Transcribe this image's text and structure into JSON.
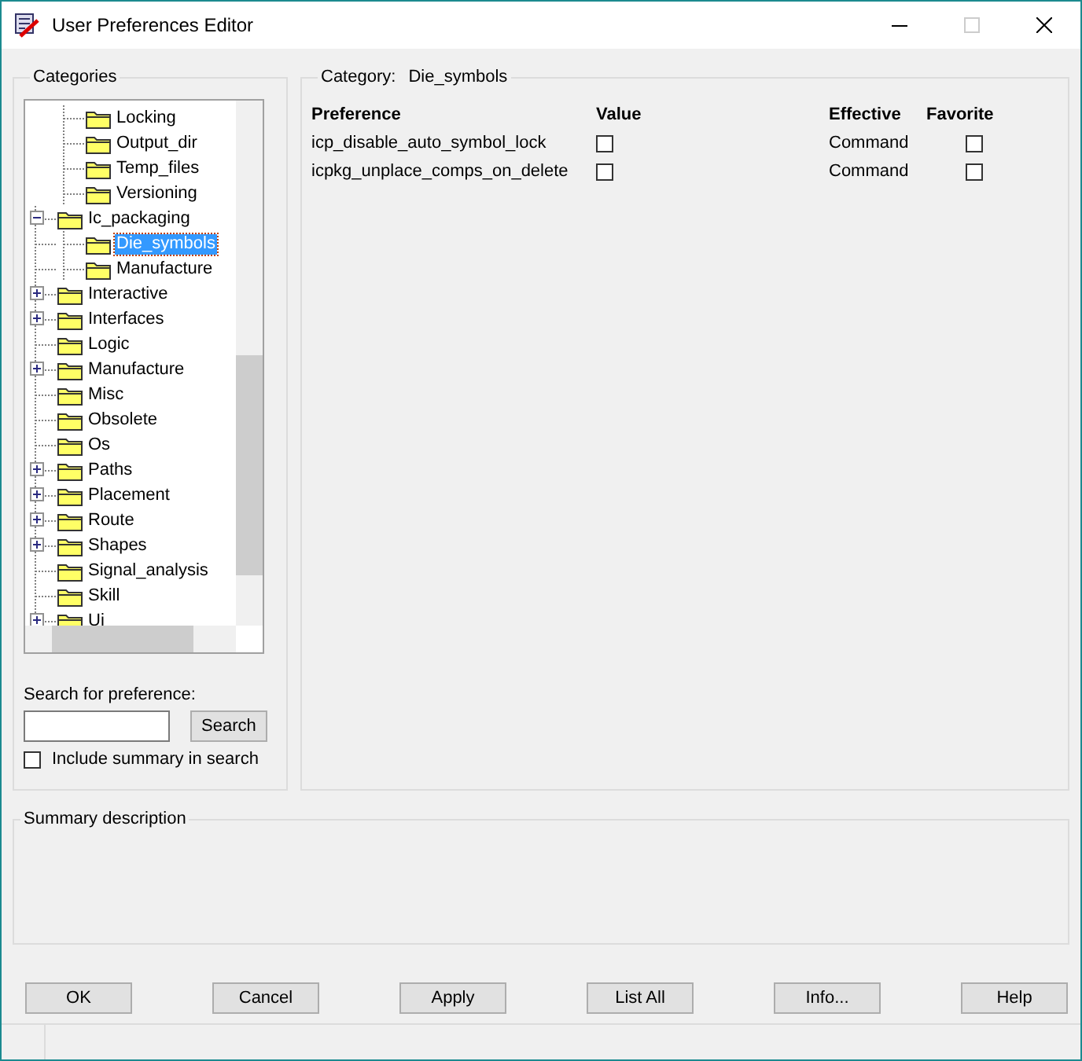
{
  "window": {
    "title": "User Preferences Editor"
  },
  "categories": {
    "title": "Categories",
    "tree": [
      {
        "kind": "offscreen",
        "children": [
          {
            "label": "Locking",
            "kind": "leaf",
            "selected": false
          },
          {
            "label": "Output_dir",
            "kind": "leaf",
            "selected": false
          },
          {
            "label": "Temp_files",
            "kind": "leaf",
            "selected": false
          },
          {
            "label": "Versioning",
            "kind": "leaf",
            "selected": false
          }
        ]
      },
      {
        "label": "Ic_packaging",
        "kind": "branch",
        "expanded": true,
        "selected": false,
        "children": [
          {
            "label": "Die_symbols",
            "kind": "leaf",
            "selected": true
          },
          {
            "label": "Manufacture",
            "kind": "leaf",
            "selected": false
          }
        ]
      },
      {
        "label": "Interactive",
        "kind": "branch",
        "expanded": false,
        "selected": false
      },
      {
        "label": "Interfaces",
        "kind": "branch",
        "expanded": false,
        "selected": false
      },
      {
        "label": "Logic",
        "kind": "leaf",
        "selected": false
      },
      {
        "label": "Manufacture",
        "kind": "branch",
        "expanded": false,
        "selected": false
      },
      {
        "label": "Misc",
        "kind": "leaf",
        "selected": false
      },
      {
        "label": "Obsolete",
        "kind": "leaf",
        "selected": false
      },
      {
        "label": "Os",
        "kind": "leaf",
        "selected": false
      },
      {
        "label": "Paths",
        "kind": "branch",
        "expanded": false,
        "selected": false
      },
      {
        "label": "Placement",
        "kind": "branch",
        "expanded": false,
        "selected": false
      },
      {
        "label": "Route",
        "kind": "branch",
        "expanded": false,
        "selected": false
      },
      {
        "label": "Shapes",
        "kind": "branch",
        "expanded": false,
        "selected": false
      },
      {
        "label": "Signal_analysis",
        "kind": "leaf",
        "selected": false
      },
      {
        "label": "Skill",
        "kind": "leaf",
        "selected": false
      },
      {
        "label": "Ui",
        "kind": "branch",
        "expanded": false,
        "selected": false
      }
    ],
    "search_label": "Search for preference:",
    "search_button": "Search",
    "include_summary": {
      "label": "Include summary in search",
      "checked": false
    }
  },
  "preferences": {
    "category_label": "Category:",
    "category": "Die_symbols",
    "columns": [
      "Preference",
      "Value",
      "Effective",
      "Favorite"
    ],
    "rows": [
      {
        "name": "icp_disable_auto_symbol_lock",
        "value": false,
        "effective": "Command",
        "favorite": false
      },
      {
        "name": "icpkg_unplace_comps_on_delete",
        "value": false,
        "effective": "Command",
        "favorite": false
      }
    ]
  },
  "summary": {
    "title": "Summary description"
  },
  "buttons": [
    "OK",
    "Cancel",
    "Apply",
    "List All",
    "Info...",
    "Help"
  ]
}
